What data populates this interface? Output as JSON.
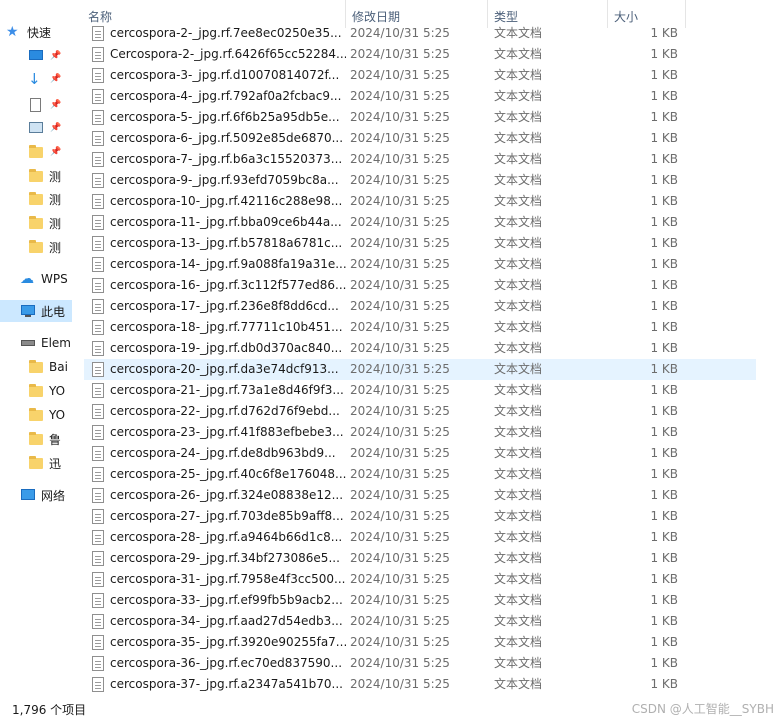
{
  "window": {
    "columns": {
      "name": "名称",
      "date": "修改日期",
      "type": "类型",
      "size": "大小"
    }
  },
  "nav": {
    "items": [
      {
        "label": "快速",
        "icon": "star-icon"
      },
      {
        "label": "",
        "icon": "desktop-icon",
        "pinned": true
      },
      {
        "label": "",
        "icon": "download-icon",
        "pinned": true
      },
      {
        "label": "",
        "icon": "document-icon",
        "pinned": true
      },
      {
        "label": "",
        "icon": "picture-icon",
        "pinned": true
      },
      {
        "label": "",
        "icon": "folder-icon",
        "pinned": true
      },
      {
        "label": "测",
        "icon": "folder-icon"
      },
      {
        "label": "测",
        "icon": "folder-icon"
      },
      {
        "label": "测",
        "icon": "folder-icon"
      },
      {
        "label": "测",
        "icon": "folder-icon"
      },
      {
        "label": "WPS",
        "icon": "cloud-icon"
      },
      {
        "label": "此电",
        "icon": "computer-icon"
      },
      {
        "label": "Elem",
        "icon": "drive-icon"
      },
      {
        "label": "Bai",
        "icon": "folder-icon"
      },
      {
        "label": "YO",
        "icon": "folder-icon"
      },
      {
        "label": "YO",
        "icon": "folder-icon"
      },
      {
        "label": "鲁",
        "icon": "folder-icon"
      },
      {
        "label": "迅",
        "icon": "folder-icon"
      },
      {
        "label": "网络",
        "icon": "network-icon"
      }
    ]
  },
  "files": [
    {
      "name": "cercospora-2-_jpg.rf.7ee8ec0250e35...",
      "date": "2024/10/31 5:25",
      "type": "文本文档",
      "size": "1 KB"
    },
    {
      "name": "Cercospora-2-_jpg.rf.6426f65cc52284...",
      "date": "2024/10/31 5:25",
      "type": "文本文档",
      "size": "1 KB"
    },
    {
      "name": "cercospora-3-_jpg.rf.d10070814072f...",
      "date": "2024/10/31 5:25",
      "type": "文本文档",
      "size": "1 KB"
    },
    {
      "name": "cercospora-4-_jpg.rf.792af0a2fcbac9...",
      "date": "2024/10/31 5:25",
      "type": "文本文档",
      "size": "1 KB"
    },
    {
      "name": "cercospora-5-_jpg.rf.6f6b25a95db5e...",
      "date": "2024/10/31 5:25",
      "type": "文本文档",
      "size": "1 KB"
    },
    {
      "name": "cercospora-6-_jpg.rf.5092e85de6870...",
      "date": "2024/10/31 5:25",
      "type": "文本文档",
      "size": "1 KB"
    },
    {
      "name": "cercospora-7-_jpg.rf.b6a3c15520373...",
      "date": "2024/10/31 5:25",
      "type": "文本文档",
      "size": "1 KB"
    },
    {
      "name": "cercospora-9-_jpg.rf.93efd7059bc8a...",
      "date": "2024/10/31 5:25",
      "type": "文本文档",
      "size": "1 KB"
    },
    {
      "name": "cercospora-10-_jpg.rf.42116c288e98...",
      "date": "2024/10/31 5:25",
      "type": "文本文档",
      "size": "1 KB"
    },
    {
      "name": "cercospora-11-_jpg.rf.bba09ce6b44a...",
      "date": "2024/10/31 5:25",
      "type": "文本文档",
      "size": "1 KB"
    },
    {
      "name": "cercospora-13-_jpg.rf.b57818a6781c...",
      "date": "2024/10/31 5:25",
      "type": "文本文档",
      "size": "1 KB"
    },
    {
      "name": "cercospora-14-_jpg.rf.9a088fa19a31e...",
      "date": "2024/10/31 5:25",
      "type": "文本文档",
      "size": "1 KB"
    },
    {
      "name": "cercospora-16-_jpg.rf.3c112f577ed86...",
      "date": "2024/10/31 5:25",
      "type": "文本文档",
      "size": "1 KB"
    },
    {
      "name": "cercospora-17-_jpg.rf.236e8f8dd6cd...",
      "date": "2024/10/31 5:25",
      "type": "文本文档",
      "size": "1 KB"
    },
    {
      "name": "cercospora-18-_jpg.rf.77711c10b451...",
      "date": "2024/10/31 5:25",
      "type": "文本文档",
      "size": "1 KB"
    },
    {
      "name": "cercospora-19-_jpg.rf.db0d370ac840...",
      "date": "2024/10/31 5:25",
      "type": "文本文档",
      "size": "1 KB"
    },
    {
      "name": "cercospora-20-_jpg.rf.da3e74dcf913...",
      "date": "2024/10/31 5:25",
      "type": "文本文档",
      "size": "1 KB",
      "hover": true
    },
    {
      "name": "cercospora-21-_jpg.rf.73a1e8d46f9f3...",
      "date": "2024/10/31 5:25",
      "type": "文本文档",
      "size": "1 KB"
    },
    {
      "name": "cercospora-22-_jpg.rf.d762d76f9ebd...",
      "date": "2024/10/31 5:25",
      "type": "文本文档",
      "size": "1 KB"
    },
    {
      "name": "cercospora-23-_jpg.rf.41f883efbebe3...",
      "date": "2024/10/31 5:25",
      "type": "文本文档",
      "size": "1 KB"
    },
    {
      "name": "cercospora-24-_jpg.rf.de8db963bd9...",
      "date": "2024/10/31 5:25",
      "type": "文本文档",
      "size": "1 KB"
    },
    {
      "name": "cercospora-25-_jpg.rf.40c6f8e176048...",
      "date": "2024/10/31 5:25",
      "type": "文本文档",
      "size": "1 KB"
    },
    {
      "name": "cercospora-26-_jpg.rf.324e08838e12...",
      "date": "2024/10/31 5:25",
      "type": "文本文档",
      "size": "1 KB"
    },
    {
      "name": "cercospora-27-_jpg.rf.703de85b9aff8...",
      "date": "2024/10/31 5:25",
      "type": "文本文档",
      "size": "1 KB"
    },
    {
      "name": "cercospora-28-_jpg.rf.a9464b66d1c8...",
      "date": "2024/10/31 5:25",
      "type": "文本文档",
      "size": "1 KB"
    },
    {
      "name": "cercospora-29-_jpg.rf.34bf273086e5...",
      "date": "2024/10/31 5:25",
      "type": "文本文档",
      "size": "1 KB"
    },
    {
      "name": "cercospora-31-_jpg.rf.7958e4f3cc500...",
      "date": "2024/10/31 5:25",
      "type": "文本文档",
      "size": "1 KB"
    },
    {
      "name": "cercospora-33-_jpg.rf.ef99fb5b9acb2...",
      "date": "2024/10/31 5:25",
      "type": "文本文档",
      "size": "1 KB"
    },
    {
      "name": "cercospora-34-_jpg.rf.aad27d54edb3...",
      "date": "2024/10/31 5:25",
      "type": "文本文档",
      "size": "1 KB"
    },
    {
      "name": "cercospora-35-_jpg.rf.3920e90255fa7...",
      "date": "2024/10/31 5:25",
      "type": "文本文档",
      "size": "1 KB"
    },
    {
      "name": "cercospora-36-_jpg.rf.ec70ed837590...",
      "date": "2024/10/31 5:25",
      "type": "文本文档",
      "size": "1 KB"
    },
    {
      "name": "cercospora-37-_jpg.rf.a2347a541b70...",
      "date": "2024/10/31 5:25",
      "type": "文本文档",
      "size": "1 KB"
    }
  ],
  "status": {
    "item_count": "1,796 个项目",
    "watermark": "CSDN @人工智能__SYBH"
  },
  "colors": {
    "selected_nav": "#cce8ff",
    "hover_row": "#e5f3ff",
    "header_text": "#4c607a",
    "secondary_text": "#6d6d6d"
  }
}
